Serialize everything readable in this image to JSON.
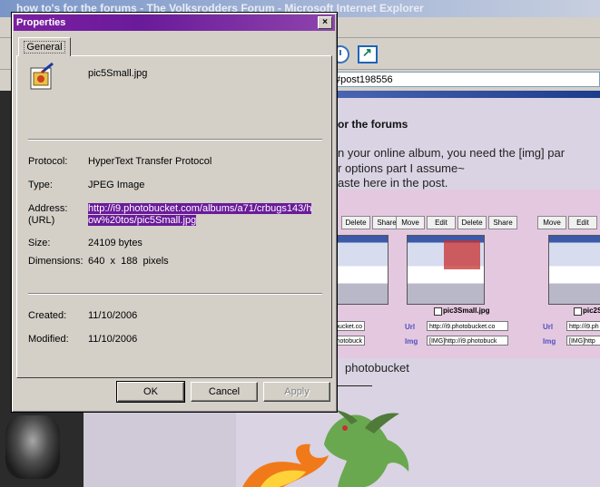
{
  "browser": {
    "title": "how to's for the forums - The Volksrodders Forum - Microsoft Internet Explorer",
    "address_fragment": "#post198556"
  },
  "page": {
    "heading": "or the forums",
    "lines": [
      "n your online album, you need the [img] par",
      "r options part I assume~",
      "aste here in the post."
    ],
    "album": {
      "card_buttons": [
        "Move",
        "Edit",
        "Delete",
        "Share"
      ],
      "cards": [
        {
          "caption": "",
          "url": "bucket.co",
          "img": "photobuck"
        },
        {
          "caption": "pic3Small.jpg",
          "url": "http://i9.photobucket.co",
          "img": "[IMG]http://i9.photobuck"
        },
        {
          "caption": "pic2S",
          "url": "http://i9.ph",
          "img": "[IMG]http"
        }
      ],
      "url_label": "Url",
      "img_label": "Img"
    },
    "footer_text": "photobucket"
  },
  "dialog": {
    "title": "Properties",
    "close_glyph": "×",
    "tab": "General",
    "file_name": "pic5Small.jpg",
    "protocol_label": "Protocol:",
    "protocol_value": "HyperText Transfer Protocol",
    "type_label": "Type:",
    "type_value": "JPEG Image",
    "address_label": "Address:",
    "address_label2": "(URL)",
    "address_value_line1": "http://i9.photobucket.com/albums/a71/crbugs143/h",
    "address_value_line2": "ow%20tos/pic5Small.jpg",
    "size_label": "Size:",
    "size_value": "24109 bytes",
    "dimensions_label": "Dimensions:",
    "dimensions_value": "640  x  188  pixels",
    "created_label": "Created:",
    "created_value": "11/10/2006",
    "modified_label": "Modified:",
    "modified_value": "11/10/2006",
    "ok_label": "OK",
    "cancel_label": "Cancel",
    "apply_label": "Apply"
  },
  "colors": {
    "dialog_titlebar": "#6a1b9a",
    "selection": "#6a1b9a",
    "window_face": "#d4d0c8"
  },
  "icons": [
    "image-file-icon",
    "close-icon",
    "history-icon",
    "new-window-icon"
  ]
}
